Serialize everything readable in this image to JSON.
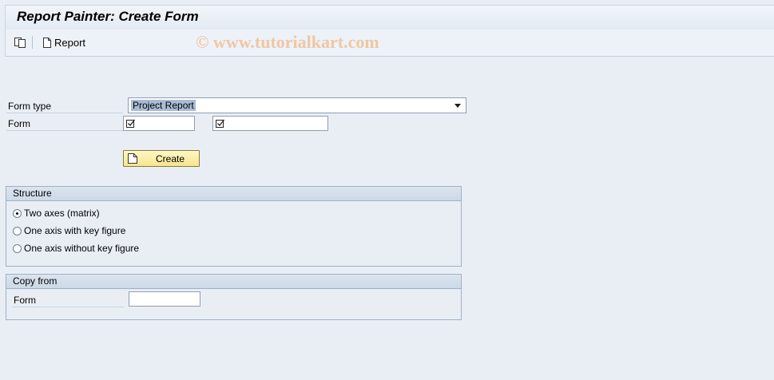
{
  "window": {
    "title": "Report Painter: Create Form"
  },
  "toolbar": {
    "icons": [
      "copy-window-icon",
      "document-icon"
    ],
    "report_label": "Report"
  },
  "watermark": "© www.tutorialkart.com",
  "form_type": {
    "label": "Form type",
    "value": "Project Report"
  },
  "form": {
    "label": "Form",
    "value1": "",
    "value2": ""
  },
  "create_button": {
    "label": "Create"
  },
  "structure": {
    "title": "Structure",
    "options": [
      {
        "label": "Two axes (matrix)",
        "selected": true
      },
      {
        "label": "One axis with key figure",
        "selected": false
      },
      {
        "label": "One axis without key figure",
        "selected": false
      }
    ]
  },
  "copy_from": {
    "title": "Copy from",
    "form_label": "Form",
    "form_value": ""
  }
}
